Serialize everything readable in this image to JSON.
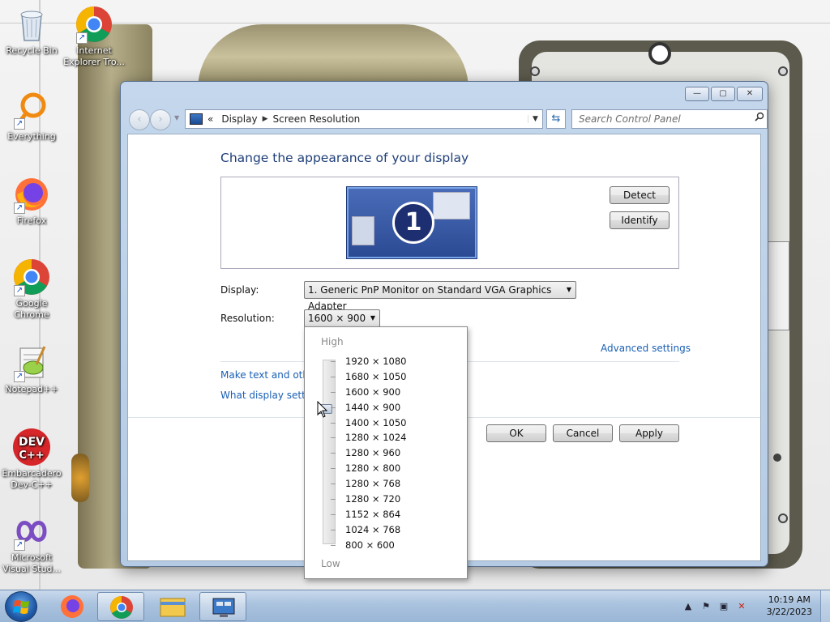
{
  "desktop": {
    "icons": [
      {
        "label": "Recycle Bin"
      },
      {
        "label": "Internet Explorer Tro..."
      },
      {
        "label": "Everything"
      },
      {
        "label": "Firefox"
      },
      {
        "label": "Google Chrome"
      },
      {
        "label": "Notepad++"
      },
      {
        "label": "Embarcadero Dev-C++"
      },
      {
        "label": "Microsoft Visual Stud..."
      }
    ]
  },
  "window": {
    "breadcrumb_prefix": "«",
    "breadcrumb": [
      "Display",
      "Screen Resolution"
    ],
    "search_placeholder": "Search Control Panel",
    "title": "Change the appearance of your display",
    "monitor_number": "1",
    "detect_label": "Detect",
    "identify_label": "Identify",
    "display_label": "Display:",
    "display_value": "1. Generic PnP Monitor on Standard VGA Graphics Adapter",
    "resolution_label": "Resolution:",
    "resolution_value": "1600 × 900",
    "advanced_link": "Advanced settings",
    "link_text_size": "Make text and other",
    "link_display_settings": "What display setting",
    "ok_label": "OK",
    "cancel_label": "Cancel",
    "apply_label": "Apply"
  },
  "resolution_dropdown": {
    "high_label": "High",
    "low_label": "Low",
    "options": [
      "1920 × 1080",
      "1680 × 1050",
      "1600 × 900",
      "1440 × 900",
      "1400 × 1050",
      "1280 × 1024",
      "1280 × 960",
      "1280 × 800",
      "1280 × 768",
      "1280 × 720",
      "1152 × 864",
      "1024 × 768",
      "800 × 600"
    ],
    "selected_index": 2
  },
  "taskbar": {
    "time": "10:19 AM",
    "date": "3/22/2023"
  },
  "colors": {
    "link": "#1a5fb4",
    "title": "#1e3e78",
    "taskbar": "#a9c2de"
  }
}
